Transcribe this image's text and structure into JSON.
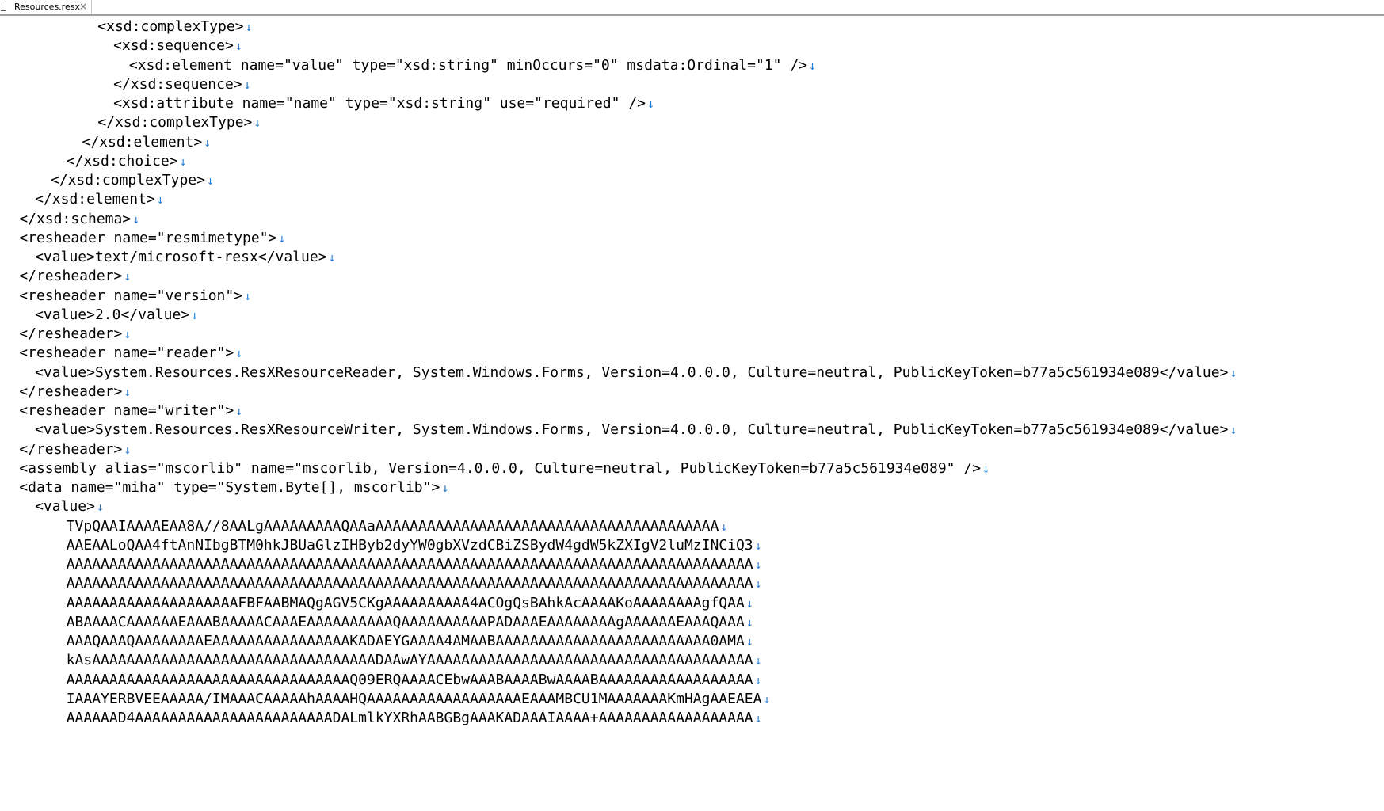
{
  "tab": {
    "filename": "Resources.resx",
    "close_glyph": "×"
  },
  "eol_glyph": "↓",
  "lines": [
    {
      "indent": 12,
      "text": "<xsd:complexType>"
    },
    {
      "indent": 14,
      "text": "<xsd:sequence>"
    },
    {
      "indent": 16,
      "text": "<xsd:element name=\"value\" type=\"xsd:string\" minOccurs=\"0\" msdata:Ordinal=\"1\" />"
    },
    {
      "indent": 14,
      "text": "</xsd:sequence>"
    },
    {
      "indent": 14,
      "text": "<xsd:attribute name=\"name\" type=\"xsd:string\" use=\"required\" />"
    },
    {
      "indent": 12,
      "text": "</xsd:complexType>"
    },
    {
      "indent": 10,
      "text": "</xsd:element>"
    },
    {
      "indent": 8,
      "text": "</xsd:choice>"
    },
    {
      "indent": 6,
      "text": "</xsd:complexType>"
    },
    {
      "indent": 4,
      "text": "</xsd:element>"
    },
    {
      "indent": 2,
      "text": "</xsd:schema>"
    },
    {
      "indent": 2,
      "text": "<resheader name=\"resmimetype\">"
    },
    {
      "indent": 4,
      "text": "<value>text/microsoft-resx</value>"
    },
    {
      "indent": 2,
      "text": "</resheader>"
    },
    {
      "indent": 2,
      "text": "<resheader name=\"version\">"
    },
    {
      "indent": 4,
      "text": "<value>2.0</value>"
    },
    {
      "indent": 2,
      "text": "</resheader>"
    },
    {
      "indent": 2,
      "text": "<resheader name=\"reader\">"
    },
    {
      "indent": 4,
      "text": "<value>System.Resources.ResXResourceReader, System.Windows.Forms, Version=4.0.0.0, Culture=neutral, PublicKeyToken=b77a5c561934e089</value>"
    },
    {
      "indent": 2,
      "text": "</resheader>"
    },
    {
      "indent": 2,
      "text": "<resheader name=\"writer\">"
    },
    {
      "indent": 4,
      "text": "<value>System.Resources.ResXResourceWriter, System.Windows.Forms, Version=4.0.0.0, Culture=neutral, PublicKeyToken=b77a5c561934e089</value>"
    },
    {
      "indent": 2,
      "text": "</resheader>"
    },
    {
      "indent": 2,
      "text": "<assembly alias=\"mscorlib\" name=\"mscorlib, Version=4.0.0.0, Culture=neutral, PublicKeyToken=b77a5c561934e089\" />"
    },
    {
      "indent": 2,
      "text": "<data name=\"miha\" type=\"System.Byte[], mscorlib\">"
    },
    {
      "indent": 4,
      "text": "<value>"
    },
    {
      "indent": 8,
      "text": "TVpQAAIAAAAEAA8A//8AALgAAAAAAAAAQAAaAAAAAAAAAAAAAAAAAAAAAAAAAAAAAAAAAAAAAAAA"
    },
    {
      "indent": 8,
      "text": "AAEAALoQAA4ftAnNIbgBTM0hkJBUaGlzIHByb2dyYW0gbXVzdCBiZSBydW4gdW5kZXIgV2luMzINCiQ3"
    },
    {
      "indent": 8,
      "text": "AAAAAAAAAAAAAAAAAAAAAAAAAAAAAAAAAAAAAAAAAAAAAAAAAAAAAAAAAAAAAAAAAAAAAAAAAAAAAAAA"
    },
    {
      "indent": 8,
      "text": "AAAAAAAAAAAAAAAAAAAAAAAAAAAAAAAAAAAAAAAAAAAAAAAAAAAAAAAAAAAAAAAAAAAAAAAAAAAAAAAA"
    },
    {
      "indent": 8,
      "text": "AAAAAAAAAAAAAAAAAAAAFBFAABMAQgAGV5CKgAAAAAAAAAA4ACOgQsBAhkAcAAAAKoAAAAAAAAgfQAA"
    },
    {
      "indent": 8,
      "text": "ABAAAACAAAAAAEAAABAAAAACAAAEAAAAAAAAAAQAAAAAAAAAAPADAAAEAAAAAAAAgAAAAAAEAAAQAAA"
    },
    {
      "indent": 8,
      "text": "AAAQAAAQAAAAAAAAEAAAAAAAAAAAAAAAAKADAEYGAAAA4AMAABAAAAAAAAAAAAAAAAAAAAAAAAA0AMA"
    },
    {
      "indent": 8,
      "text": "kAsAAAAAAAAAAAAAAAAAAAAAAAAAAAAAAAAADAAwAYAAAAAAAAAAAAAAAAAAAAAAAAAAAAAAAAAAAAAA"
    },
    {
      "indent": 8,
      "text": "AAAAAAAAAAAAAAAAAAAAAAAAAAAAAAAAAQ09ERQAAAACEbwAAABAAAABwAAAABAAAAAAAAAAAAAAAAAA"
    },
    {
      "indent": 8,
      "text": "IAAAYERBVEEAAAAA/IMAAACAAAAAhAAAAHQAAAAAAAAAAAAAAAAAAEAAAMBCU1MAAAAAAAKmHAgAAEAEA"
    },
    {
      "indent": 8,
      "text": "AAAAAAD4AAAAAAAAAAAAAAAAAAAAAAADALmlkYXRhAABGBgAAAKADAAAIAAAA+AAAAAAAAAAAAAAAAAA"
    }
  ]
}
